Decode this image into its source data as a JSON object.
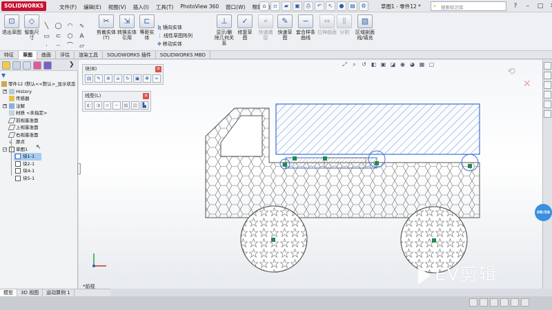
{
  "app": {
    "logo": "SOLIDWORKS",
    "menu": [
      "文件(F)",
      "编辑(E)",
      "视图(V)",
      "插入(I)",
      "工具(T)",
      "PhotoView 360",
      "窗口(W)",
      "帮助(H)"
    ],
    "document_title": "草图1 - 零件12 *",
    "search_placeholder": "搜索知识库"
  },
  "ribbon": {
    "sketch_exit": "退出草图",
    "smart_dimension": "智能尺寸",
    "trim": "剪裁实体(T)",
    "convert": "转换实体引用",
    "offset": "等距实体",
    "mirror": "镜向实体",
    "linear_pattern": "线性草图阵列",
    "move": "移动实体",
    "display_delete": "显示/删除几何关系",
    "repair": "修复草图",
    "quick_snap": "快速捕捉",
    "quick_sketch": "快速草图",
    "instant2d": "Instant2D",
    "shaded_contours": "上色草图轮廓",
    "rapid_sketch": "套合样条曲线",
    "stretch": "拉伸曲面",
    "split": "分割",
    "hatch": "区域剖面线/填充"
  },
  "tabs": [
    "特征",
    "草图",
    "曲面",
    "评估",
    "渲染工具",
    "SOLIDWORKS 插件",
    "SOLIDWORKS MBD"
  ],
  "tree": {
    "root": "零件12 (默认<<默认>_显示状态",
    "history": "History",
    "sensors": "传感器",
    "annotations": "注解",
    "material": "材质 <未指定>",
    "front": "前视基准面",
    "top": "上视基准面",
    "right": "右视基准面",
    "origin": "原点",
    "sketch": "草图1",
    "blocks": [
      "块1-1",
      "块2-1",
      "块4-1",
      "块5-1"
    ]
  },
  "floating": {
    "block_title": "块(B)",
    "line_title": "线型(L)"
  },
  "view": {
    "label": "*前视",
    "recorder": "08:56",
    "watermark": "EV剪辑"
  },
  "model_tabs": [
    "模型",
    "3D 视图",
    "运动算例 1"
  ],
  "colors": {
    "sketch_line": "#555555",
    "selected_block": "#3b6fd6",
    "accent_red": "#d9534f",
    "tree_selection": "#a9cdf2"
  }
}
